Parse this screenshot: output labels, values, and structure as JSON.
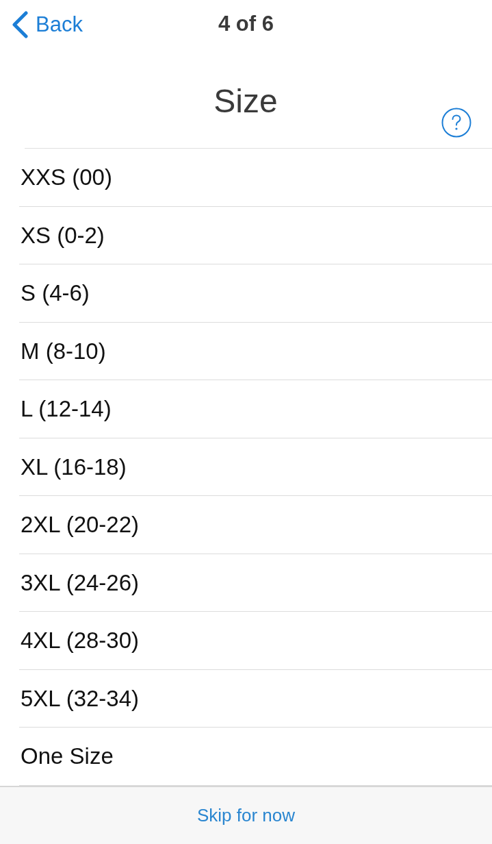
{
  "nav": {
    "back_label": "Back",
    "step": "4 of 6"
  },
  "title": "Size",
  "sizes": [
    "XXS (00)",
    "XS (0-2)",
    "S (4-6)",
    "M (8-10)",
    "L (12-14)",
    "XL (16-18)",
    "2XL (20-22)",
    "3XL (24-26)",
    "4XL (28-30)",
    "5XL (32-34)",
    "One Size"
  ],
  "footer": {
    "skip_label": "Skip for now"
  }
}
